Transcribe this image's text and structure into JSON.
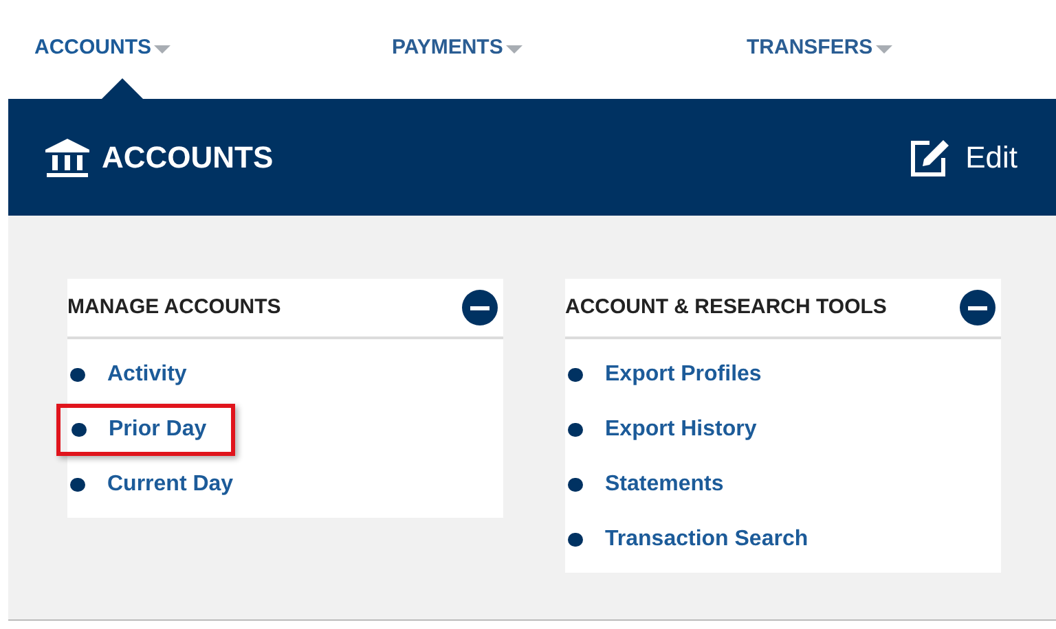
{
  "nav_tabs": [
    {
      "label": "ACCOUNTS",
      "selected": true
    },
    {
      "label": "PAYMENTS",
      "selected": false
    },
    {
      "label": "TRANSFERS",
      "selected": false
    }
  ],
  "banner": {
    "title": "ACCOUNTS",
    "edit_label": "Edit"
  },
  "panels": [
    {
      "title": "MANAGE ACCOUNTS",
      "expanded": true,
      "items": [
        {
          "label": "Activity",
          "highlighted": false
        },
        {
          "label": "Prior Day",
          "highlighted": true
        },
        {
          "label": "Current Day",
          "highlighted": false
        }
      ]
    },
    {
      "title": "ACCOUNT & RESEARCH TOOLS",
      "expanded": true,
      "items": [
        {
          "label": "Export Profiles",
          "highlighted": false
        },
        {
          "label": "Export History",
          "highlighted": false
        },
        {
          "label": "Statements",
          "highlighted": false
        },
        {
          "label": "Transaction Search",
          "highlighted": false
        }
      ]
    }
  ]
}
